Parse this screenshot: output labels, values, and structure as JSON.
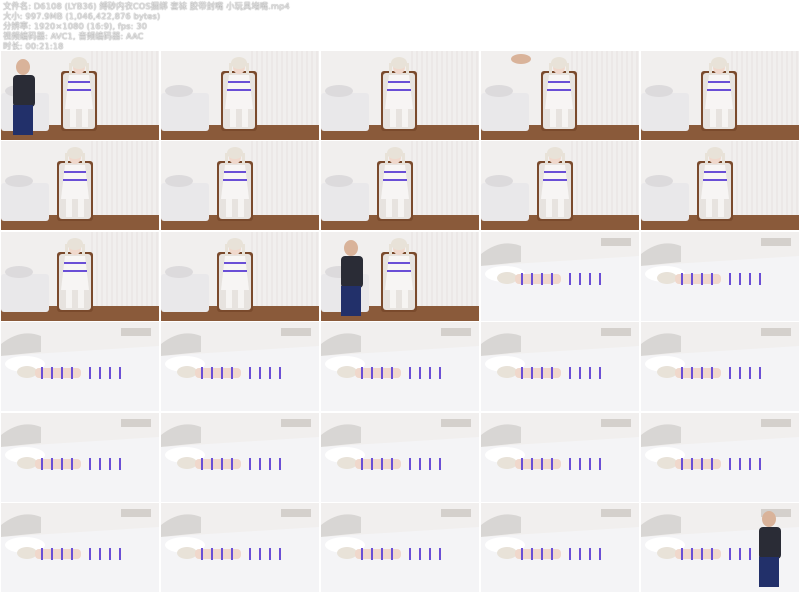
{
  "info": {
    "filename": "文件名: D6108 (LYB36) 缚砂内衣COS捆绑 套袜 胶带封嘴 小玩具堵嘴.mp4",
    "size": "大小: 997.9MB (1,046,422,876 bytes)",
    "resolution": "分辨率: 1920×1080 (16:9), fps: 30",
    "codec": "视频编码器: AVC1, 音频编码器: AAC",
    "duration": "时长: 00:21:18"
  },
  "thumbnails": [
    {
      "scene": "chair-man-left"
    },
    {
      "scene": "chair"
    },
    {
      "scene": "chair"
    },
    {
      "scene": "chair-hand"
    },
    {
      "scene": "chair-tied"
    },
    {
      "scene": "chair-side"
    },
    {
      "scene": "chair-side"
    },
    {
      "scene": "chair-side"
    },
    {
      "scene": "chair-side"
    },
    {
      "scene": "chair-side"
    },
    {
      "scene": "chair-side"
    },
    {
      "scene": "chair-side"
    },
    {
      "scene": "chair-man-sitting"
    },
    {
      "scene": "bed-close"
    },
    {
      "scene": "bed-close"
    },
    {
      "scene": "bed-wide"
    },
    {
      "scene": "bed-wide"
    },
    {
      "scene": "bed-wide"
    },
    {
      "scene": "bed-wide"
    },
    {
      "scene": "bed-wide"
    },
    {
      "scene": "bed-wide"
    },
    {
      "scene": "bed-wide"
    },
    {
      "scene": "bed-wide"
    },
    {
      "scene": "bed-wide"
    },
    {
      "scene": "bed-wide"
    },
    {
      "scene": "bed-wide"
    },
    {
      "scene": "bed-wide"
    },
    {
      "scene": "bed-wide"
    },
    {
      "scene": "bed-wide"
    },
    {
      "scene": "bed-man"
    }
  ],
  "colors": {
    "wall": "#f1efee",
    "curtain": "#ece8e7",
    "floor": "#8a5a3a",
    "rope": "#6a4fd6",
    "sheet": "#f4f4f6",
    "headboard": "#d8d6d4",
    "skin": "#f0d8cc",
    "dark": "#2a2c36"
  }
}
